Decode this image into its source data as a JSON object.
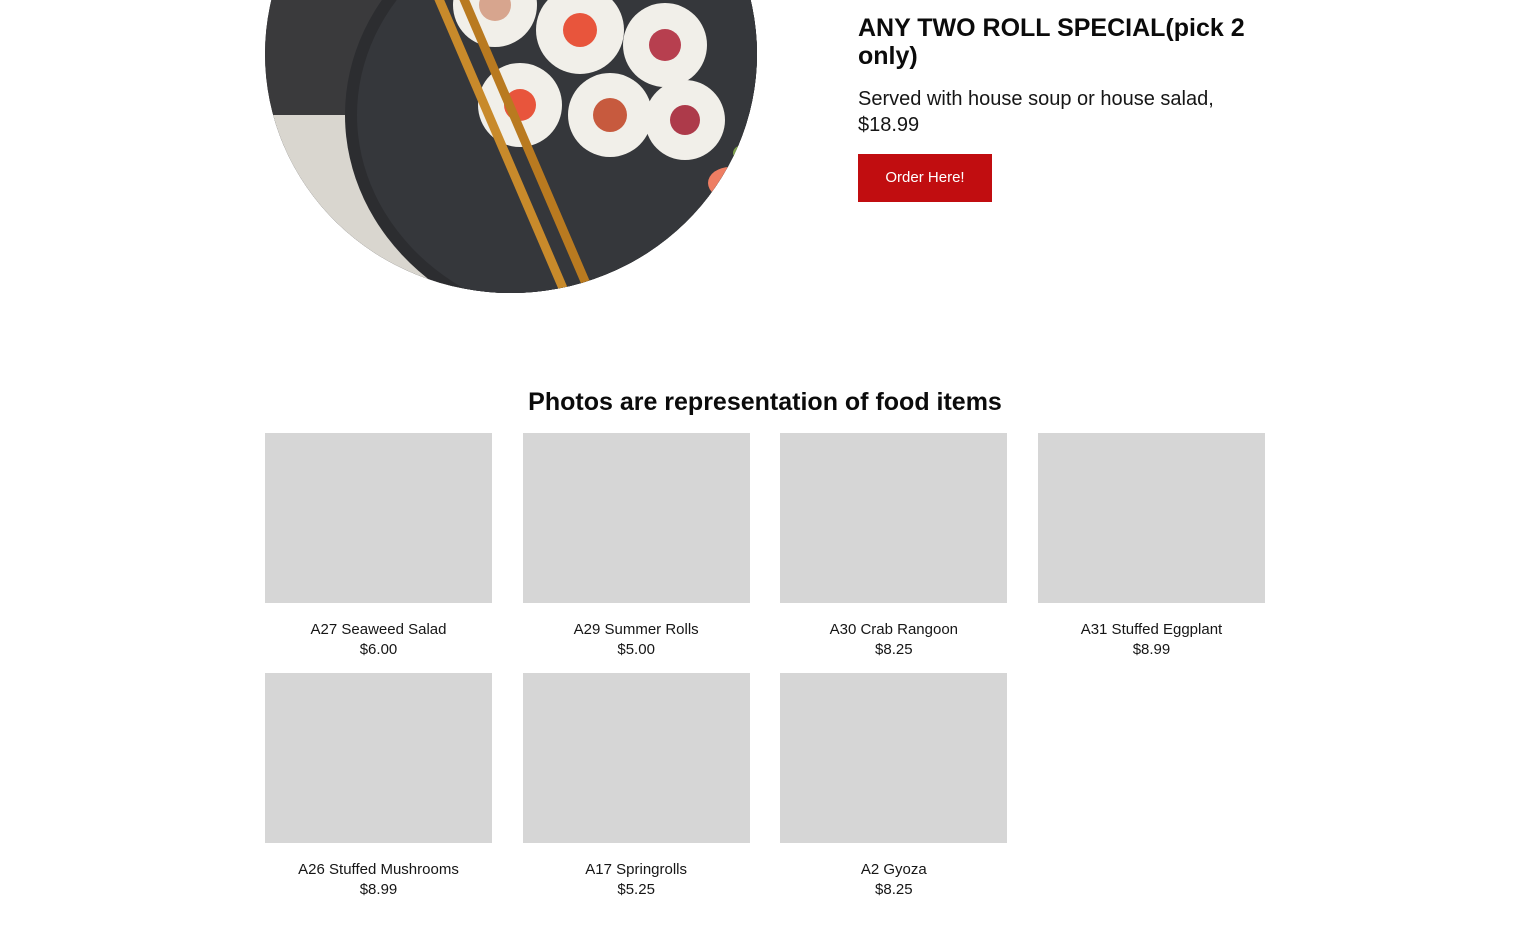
{
  "hero": {
    "title": "ANY TWO ROLL SPECIAL(pick 2 only)",
    "description": "Served with house soup or house salad, $18.99",
    "order_label": "Order Here!"
  },
  "gallery": {
    "heading": "Photos are representation of food items",
    "items": [
      {
        "name": "A27 Seaweed Salad",
        "price": "$6.00"
      },
      {
        "name": "A29 Summer Rolls",
        "price": "$5.00"
      },
      {
        "name": "A30 Crab Rangoon",
        "price": "$8.25"
      },
      {
        "name": "A31 Stuffed Eggplant",
        "price": "$8.99"
      },
      {
        "name": "A26 Stuffed Mushrooms",
        "price": "$8.99"
      },
      {
        "name": "A17 Springrolls",
        "price": "$5.25"
      },
      {
        "name": "A2 Gyoza",
        "price": "$8.25"
      }
    ]
  },
  "colors": {
    "accent": "#c10d10",
    "placeholder": "#d6d6d6"
  }
}
